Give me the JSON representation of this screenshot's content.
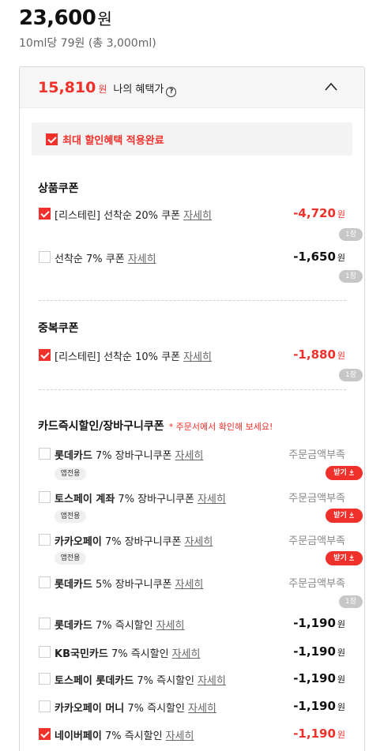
{
  "price": {
    "amount": "23,600",
    "unit": "원"
  },
  "unit_price": "10ml당 79원 (총 3,000ml)",
  "benefit": {
    "amount": "15,810",
    "unit": "원",
    "label": "나의 혜택가",
    "help": "?"
  },
  "applied_label": "최대 할인혜택 적용완료",
  "sections": {
    "product": "상품쿠폰",
    "duplicate": "중복쿠폰",
    "card": "카드즉시할인/장바구니쿠폰",
    "card_note": "* 주문서에서 확인해 보세요!"
  },
  "detail_label": "자세히",
  "qty_label": "1장",
  "app_only_label": "앱전용",
  "get_label": "받기",
  "won": "원",
  "insufficient_label": "주문금액부족",
  "product_coupons": [
    {
      "checked": true,
      "label": "[리스테린] 선착순 20% 쿠폰",
      "amount": "-4,720",
      "red": true
    },
    {
      "checked": false,
      "label": "선착순 7% 쿠폰",
      "amount": "-1,650",
      "red": false
    }
  ],
  "duplicate_coupons": [
    {
      "checked": true,
      "label": "[리스테린] 선착순 10% 쿠폰",
      "amount": "-1,880",
      "red": true
    }
  ],
  "card_coupons": [
    {
      "bold": "롯데카드",
      "rest": " 7% 장바구니쿠폰"
    },
    {
      "bold": "토스페이 계좌",
      "rest": " 7% 장바구니쿠폰"
    },
    {
      "bold": "카카오페이",
      "rest": " 7% 장바구니쿠폰"
    },
    {
      "bold": "롯데카드",
      "rest": " 5% 장바구니쿠폰"
    }
  ],
  "instant_discounts": [
    {
      "checked": false,
      "bold": "롯데카드",
      "rest": " 7% 즉시할인",
      "amount": "-1,190",
      "red": false
    },
    {
      "checked": false,
      "bold": "KB국민카드",
      "rest": " 7% 즉시할인",
      "amount": "-1,190",
      "red": false
    },
    {
      "checked": false,
      "bold": "토스페이 롯데카드",
      "rest": " 7% 즉시할인",
      "amount": "-1,190",
      "red": false
    },
    {
      "checked": false,
      "bold": "카카오페이 머니",
      "rest": " 7% 즉시할인",
      "amount": "-1,190",
      "red": false
    },
    {
      "checked": true,
      "bold": "네이버페이",
      "rest": " 7% 즉시할인",
      "amount": "-1,190",
      "red": true
    }
  ],
  "colors": {
    "accent": "#f0302a",
    "muted": "#888888",
    "badge": "#c7c7c7"
  },
  "icons": {
    "collapse": "chevron-up-icon",
    "download": "download-icon",
    "help": "help-circle-icon",
    "check": "check-icon"
  }
}
